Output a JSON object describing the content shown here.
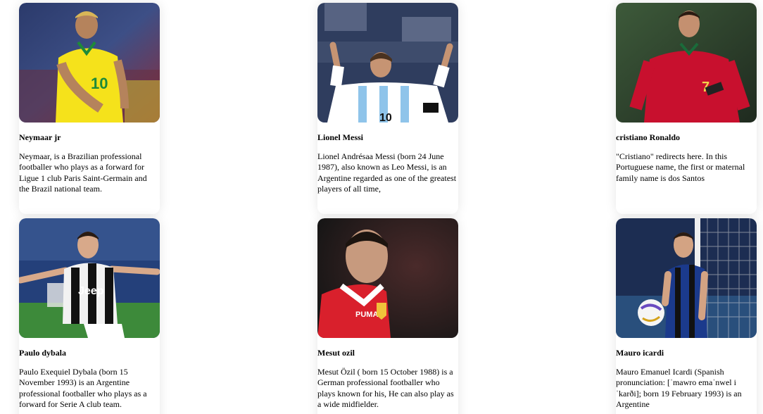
{
  "players": [
    {
      "name": "Neymaar jr",
      "description": "Neymaar, is a Brazilian professional footballer who plays as a forward for Ligue 1 club Paris Saint-Germain and the Brazil national team.",
      "photo": "player-photo-brazil-yellow-kit",
      "colors": {
        "shirt": "#f5e21b",
        "background": "#3b4a7a"
      }
    },
    {
      "name": "Lionel Messi",
      "description": "Lionel Andrésaa Messi (born 24 June 1987), also known as Leo Messi, is an Argentine regarded as one of the greatest players of all time,",
      "photo": "player-photo-argentina-striped-kit",
      "colors": {
        "shirt": "#ffffff",
        "background": "#31405e"
      }
    },
    {
      "name": "cristiano Ronaldo",
      "description": "\"Cristiano\" redirects here. In this Portuguese name, the first or maternal family name is dos Santos",
      "photo": "player-photo-portugal-red-kit",
      "colors": {
        "shirt": "#c8102e",
        "background": "#2f4a2e"
      }
    },
    {
      "name": "Paulo dybala",
      "description": "Paulo Exequiel Dybala (born 15 November 1993) is an Argentine professional footballer who plays as a forward for Serie A club team.",
      "photo": "player-photo-juventus-kit",
      "colors": {
        "shirt": "#111111",
        "background": "#2c4a8a"
      }
    },
    {
      "name": "Mesut ozil",
      "description": "Mesut Özil ( born 15 October 1988) is a German professional footballer who plays known for his, He can also play as a wide midfielder.",
      "photo": "player-photo-arsenal-kit",
      "colors": {
        "shirt": "#d9202c",
        "background": "#1a1a1a"
      }
    },
    {
      "name": "Mauro icardi",
      "description": "Mauro Emanuel Icardi (Spanish pronunciation: [ˈmawro emaˈnwel i ˈkarði]; born 19 February 1993) is an Argentine",
      "photo": "player-photo-inter-kit",
      "colors": {
        "shirt": "#1b3a8c",
        "background": "#1e2f55"
      }
    }
  ]
}
